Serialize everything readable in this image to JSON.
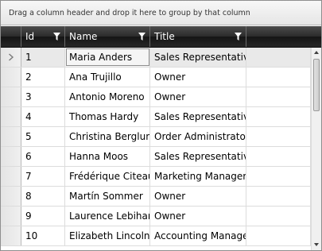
{
  "group_panel": {
    "hint": "Drag a column header and drop it here to group by that column"
  },
  "columns": [
    {
      "label": "Id",
      "filter_icon": "filter-icon"
    },
    {
      "label": "Name",
      "filter_icon": "filter-icon"
    },
    {
      "label": "Title",
      "filter_icon": "filter-icon"
    }
  ],
  "rows": [
    {
      "id": "1",
      "name": "Maria Anders",
      "title": "Sales Representative"
    },
    {
      "id": "2",
      "name": "Ana Trujillo",
      "title": "Owner"
    },
    {
      "id": "3",
      "name": "Antonio Moreno",
      "title": "Owner"
    },
    {
      "id": "4",
      "name": "Thomas Hardy",
      "title": "Sales Representative"
    },
    {
      "id": "5",
      "name": "Christina Berglund",
      "title": "Order Administrator"
    },
    {
      "id": "6",
      "name": "Hanna Moos",
      "title": "Sales Representative"
    },
    {
      "id": "7",
      "name": "Frédérique Citeaux",
      "title": "Marketing Manager"
    },
    {
      "id": "8",
      "name": "Martín Sommer",
      "title": "Owner"
    },
    {
      "id": "9",
      "name": "Laurence Lebihan",
      "title": "Owner"
    },
    {
      "id": "10",
      "name": "Elizabeth Lincoln",
      "title": "Accounting Manager"
    }
  ],
  "current_row_indicator_icon": "chevron-right-icon",
  "colors": {
    "header_bg": "#2b2b2b",
    "header_text": "#ffffff",
    "grid_line": "#dcdcdc",
    "current_row_bg": "#e9e9e9"
  }
}
